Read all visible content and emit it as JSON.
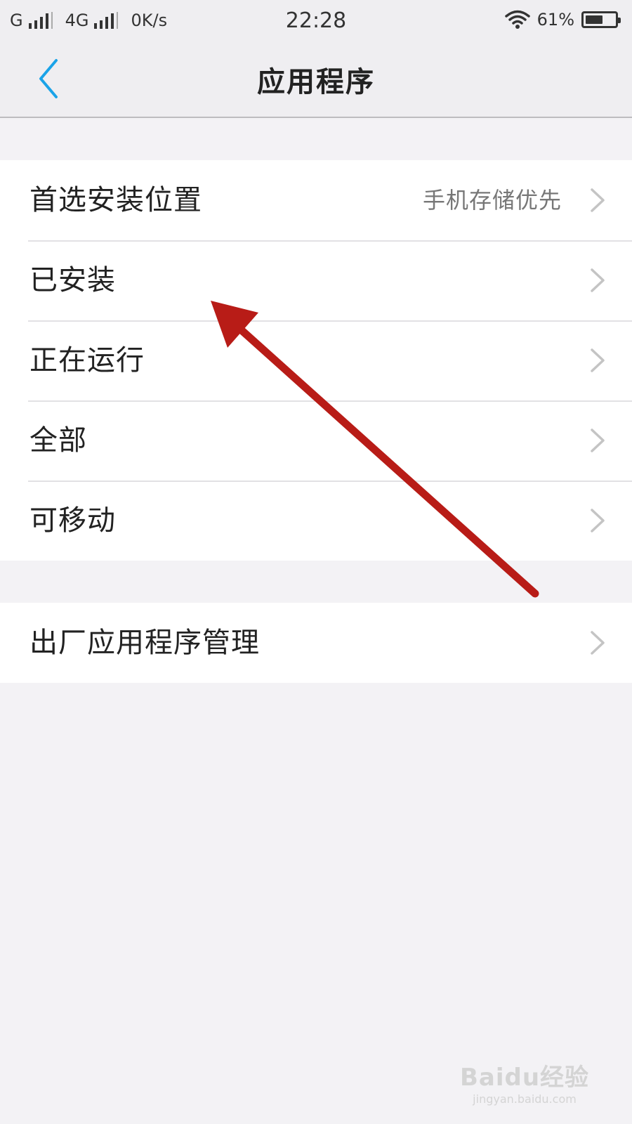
{
  "status_bar": {
    "carrier1": "G",
    "carrier2": "4G",
    "speed": "0K/s",
    "time": "22:28",
    "battery_text": "61%",
    "battery_level": 0.61,
    "wifi_icon": "wifi-icon"
  },
  "nav": {
    "title": "应用程序",
    "back_icon": "chevron-left-icon",
    "accent_color": "#1aa3e8"
  },
  "settings": {
    "group1": [
      {
        "label": "首选安装位置",
        "value": "手机存储优先"
      },
      {
        "label": "已安装"
      },
      {
        "label": "正在运行"
      },
      {
        "label": "全部"
      },
      {
        "label": "可移动"
      }
    ],
    "group2": [
      {
        "label": "出厂应用程序管理"
      }
    ]
  },
  "annotation": {
    "color": "#b81c17"
  },
  "watermark": {
    "logo": "Baidu经验",
    "url": "jingyan.baidu.com"
  }
}
